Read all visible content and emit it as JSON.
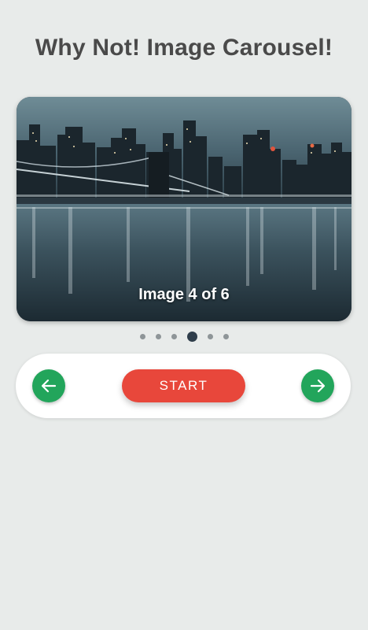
{
  "page": {
    "title": "Why Not! Image Carousel!"
  },
  "carousel": {
    "caption": "Image 4 of 6",
    "current_index": 4,
    "total": 6
  },
  "controls": {
    "prev_icon": "arrow-left-icon",
    "next_icon": "arrow-right-icon",
    "start_label": "START"
  },
  "colors": {
    "background": "#e8ebea",
    "title": "#4a4a4a",
    "nav_green": "#22a55b",
    "start_red": "#e8473b",
    "dot_active": "#2f3e4b",
    "dot_inactive": "#8e9598"
  }
}
